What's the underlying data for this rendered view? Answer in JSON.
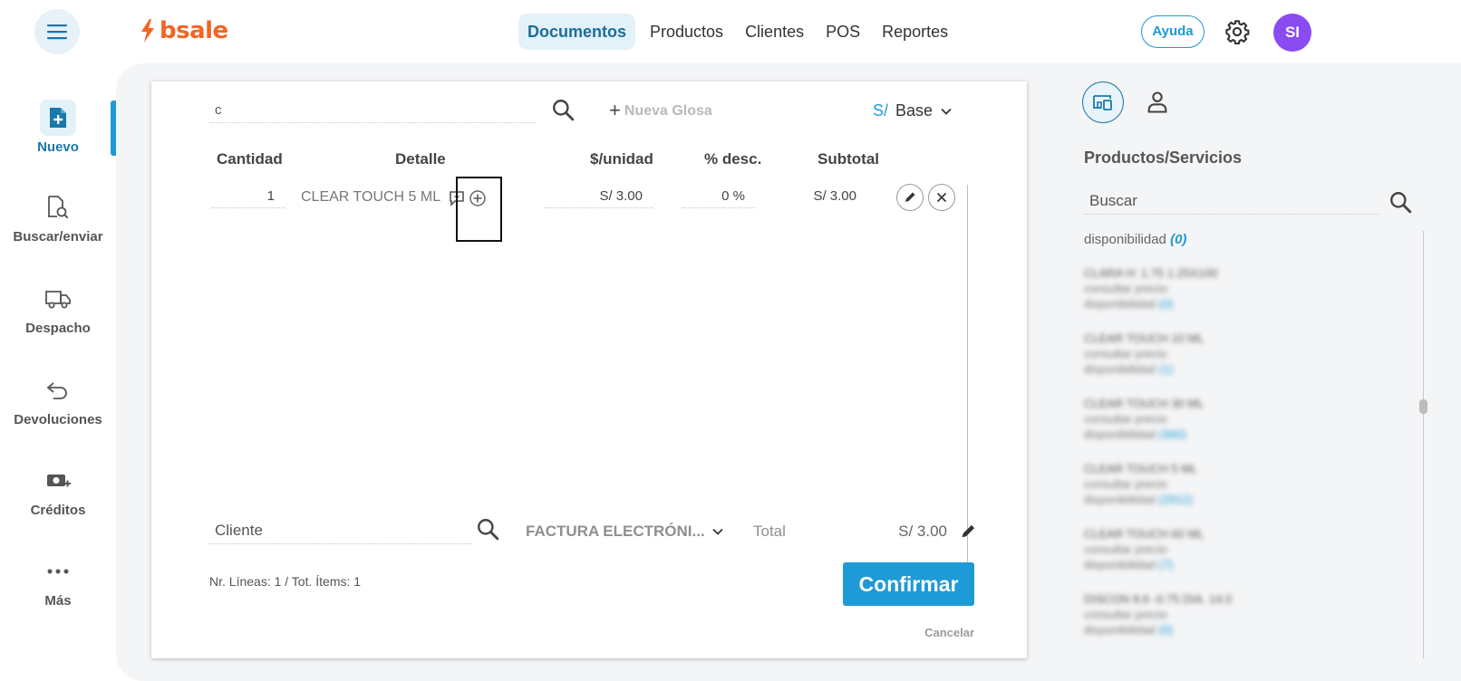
{
  "topbar": {
    "logo_text": "bsale",
    "tabs": [
      {
        "label": "Documentos",
        "active": true
      },
      {
        "label": "Productos",
        "active": false
      },
      {
        "label": "Clientes",
        "active": false
      },
      {
        "label": "POS",
        "active": false
      },
      {
        "label": "Reportes",
        "active": false
      }
    ],
    "help_label": "Ayuda",
    "avatar_initials": "SI",
    "avatar_color": "#8a4cf0",
    "brand_color": "#f26522"
  },
  "sidebar": {
    "items": [
      {
        "label": "Nuevo",
        "icon": "file-plus-icon",
        "active": true
      },
      {
        "label": "Buscar/enviar",
        "icon": "file-search-icon",
        "active": false
      },
      {
        "label": "Despacho",
        "icon": "truck-icon",
        "active": false
      },
      {
        "label": "Devoluciones",
        "icon": "return-arrow-icon",
        "active": false
      },
      {
        "label": "Créditos",
        "icon": "credit-money-icon",
        "active": false
      },
      {
        "label": "Más",
        "icon": "more-dots-icon",
        "active": false
      }
    ]
  },
  "document": {
    "search_value": "c",
    "new_glosa_label": "Nueva Glosa",
    "currency_symbol": "S/",
    "price_list": "Base",
    "columns": {
      "qty": "Cantidad",
      "detail": "Detalle",
      "unit_price": "$/unidad",
      "discount": "% desc.",
      "subtotal": "Subtotal"
    },
    "rows": [
      {
        "qty": "1",
        "name": "CLEAR TOUCH 5 ML",
        "unit_price": "S/ 3.00",
        "discount": "0 %",
        "subtotal": "S/ 3.00"
      }
    ],
    "client_placeholder": "Cliente",
    "doc_type": "FACTURA ELECTRÓNI...",
    "total_label": "Total",
    "total_value": "S/ 3.00",
    "counts": "Nr. Líneas: 1 / Tot. Ítems: 1",
    "confirm_label": "Confirmar",
    "cancel_label": "Cancelar",
    "accent_color": "#1e9ad6"
  },
  "right_panel": {
    "title": "Productos/Servicios",
    "search_placeholder": "Buscar",
    "availability_label": "disponibilidad",
    "availability_count": "(0)",
    "items": [
      {
        "name": "CLARA H: 1.75 1.25X100",
        "line2": "consultar precio",
        "line3": "disponibilidad",
        "count": "(0)"
      },
      {
        "name": "CLEAR TOUCH 10 ML",
        "line2": "consultar precio",
        "line3": "disponibilidad",
        "count": "(1)"
      },
      {
        "name": "CLEAR TOUCH 30 ML",
        "line2": "consultar precio",
        "line3": "disponibilidad",
        "count": "(360)"
      },
      {
        "name": "CLEAR TOUCH 5 ML",
        "line2": "consultar precio",
        "line3": "disponibilidad",
        "count": "(2912)"
      },
      {
        "name": "CLEAR TOUCH 60 ML",
        "line2": "consultar precio",
        "line3": "disponibilidad",
        "count": "(7)"
      },
      {
        "name": "DISCON 8.6 -0.75 DIA. 14.0",
        "line2": "consultar precio",
        "line3": "disponibilidad",
        "count": "(0)"
      }
    ]
  }
}
